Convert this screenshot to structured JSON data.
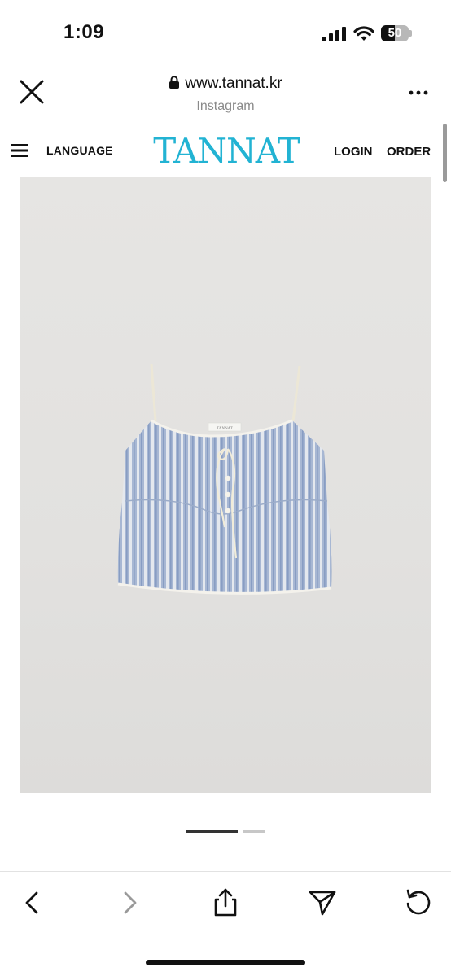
{
  "status_bar": {
    "time": "1:09",
    "battery_level": "50",
    "battery_fraction": 0.5
  },
  "browser": {
    "url": "www.tannat.kr",
    "source": "Instagram",
    "icons": [
      "close-icon",
      "lock-icon",
      "more-icon"
    ]
  },
  "site_header": {
    "language_label": "LANGUAGE",
    "brand": "TANNAT",
    "brand_color": "#22b3d3",
    "login_label": "LOGIN",
    "order_label": "ORDER"
  },
  "product": {
    "tag_text": "TANNAT",
    "image_subject": "blue-white striped camisole top"
  },
  "carousel": {
    "active_index": 0,
    "count": 2
  },
  "toolbar": {
    "icons": [
      "back-icon",
      "forward-icon",
      "share-icon",
      "send-icon",
      "reload-icon"
    ],
    "forward_enabled": false
  }
}
